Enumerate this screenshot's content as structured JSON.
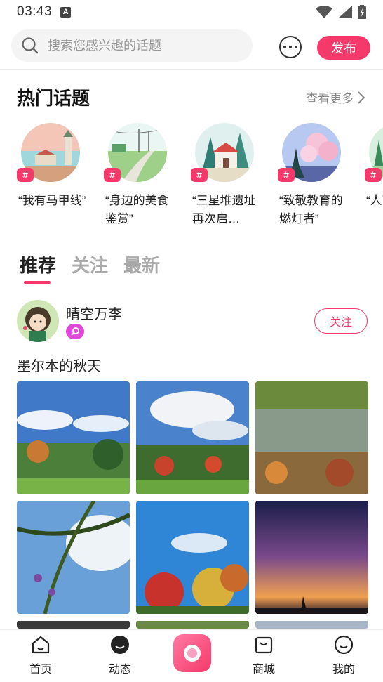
{
  "status_bar": {
    "time": "03:43",
    "notif_icon": "A"
  },
  "search": {
    "placeholder": "搜索您感兴趣的话题"
  },
  "header": {
    "publish_label": "发布"
  },
  "hot_topics": {
    "title": "热门话题",
    "see_more": "查看更多",
    "tag_symbol": "#",
    "items": [
      {
        "label": "“我有马甲线”"
      },
      {
        "label": "“身边的美食鉴赏”"
      },
      {
        "label": "“三星堆遗址再次启…"
      },
      {
        "label": "“致敬教育的燃灯者”"
      },
      {
        "label": "“人节”"
      }
    ]
  },
  "tabs": [
    {
      "label": "推荐"
    },
    {
      "label": "关注"
    },
    {
      "label": "最新"
    }
  ],
  "post": {
    "username": "晴空万李",
    "follow_label": "关注",
    "text": "墨尔本的秋天"
  },
  "bottom_nav": [
    {
      "label": "首页",
      "icon": "home-icon"
    },
    {
      "label": "动态",
      "icon": "feed-icon"
    },
    {
      "label": "",
      "icon": "camera-center-icon"
    },
    {
      "label": "商城",
      "icon": "shop-icon"
    },
    {
      "label": "我的",
      "icon": "profile-icon"
    }
  ],
  "colors": {
    "accent": "#f5396a",
    "badge": "#e048d8"
  }
}
